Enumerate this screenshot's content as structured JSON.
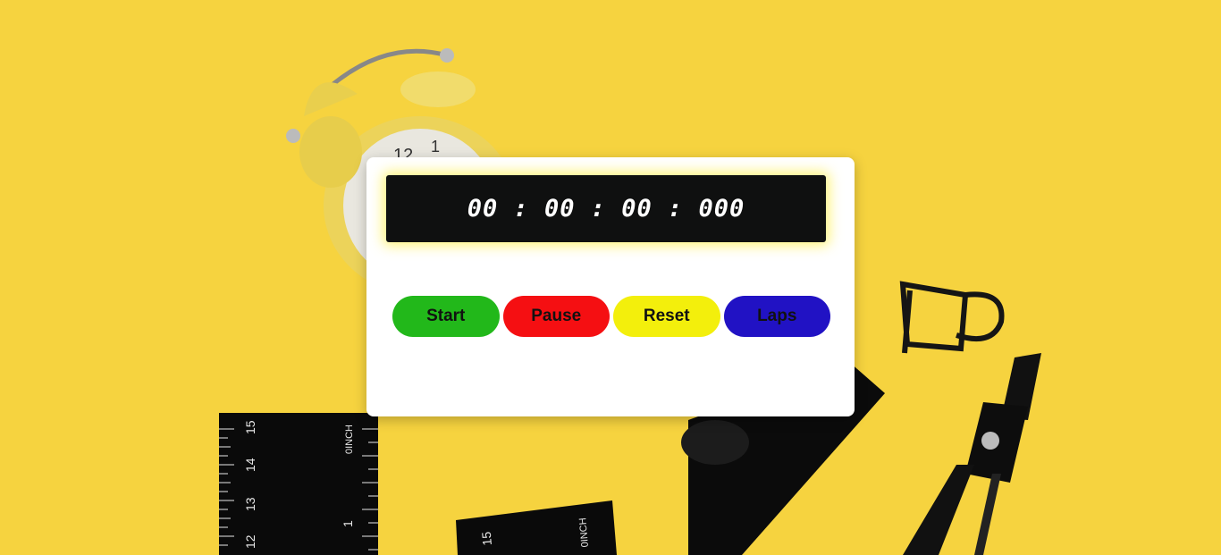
{
  "stopwatch": {
    "display_time": "00 : 00 : 00 : 000",
    "buttons": {
      "start": "Start",
      "pause": "Pause",
      "reset": "Reset",
      "laps": "Laps"
    }
  },
  "colors": {
    "background": "#f6d33f",
    "start": "#22b81a",
    "pause": "#f50f12",
    "reset": "#f3ef0c",
    "laps": "#2112c4",
    "display": "#0f1010"
  }
}
